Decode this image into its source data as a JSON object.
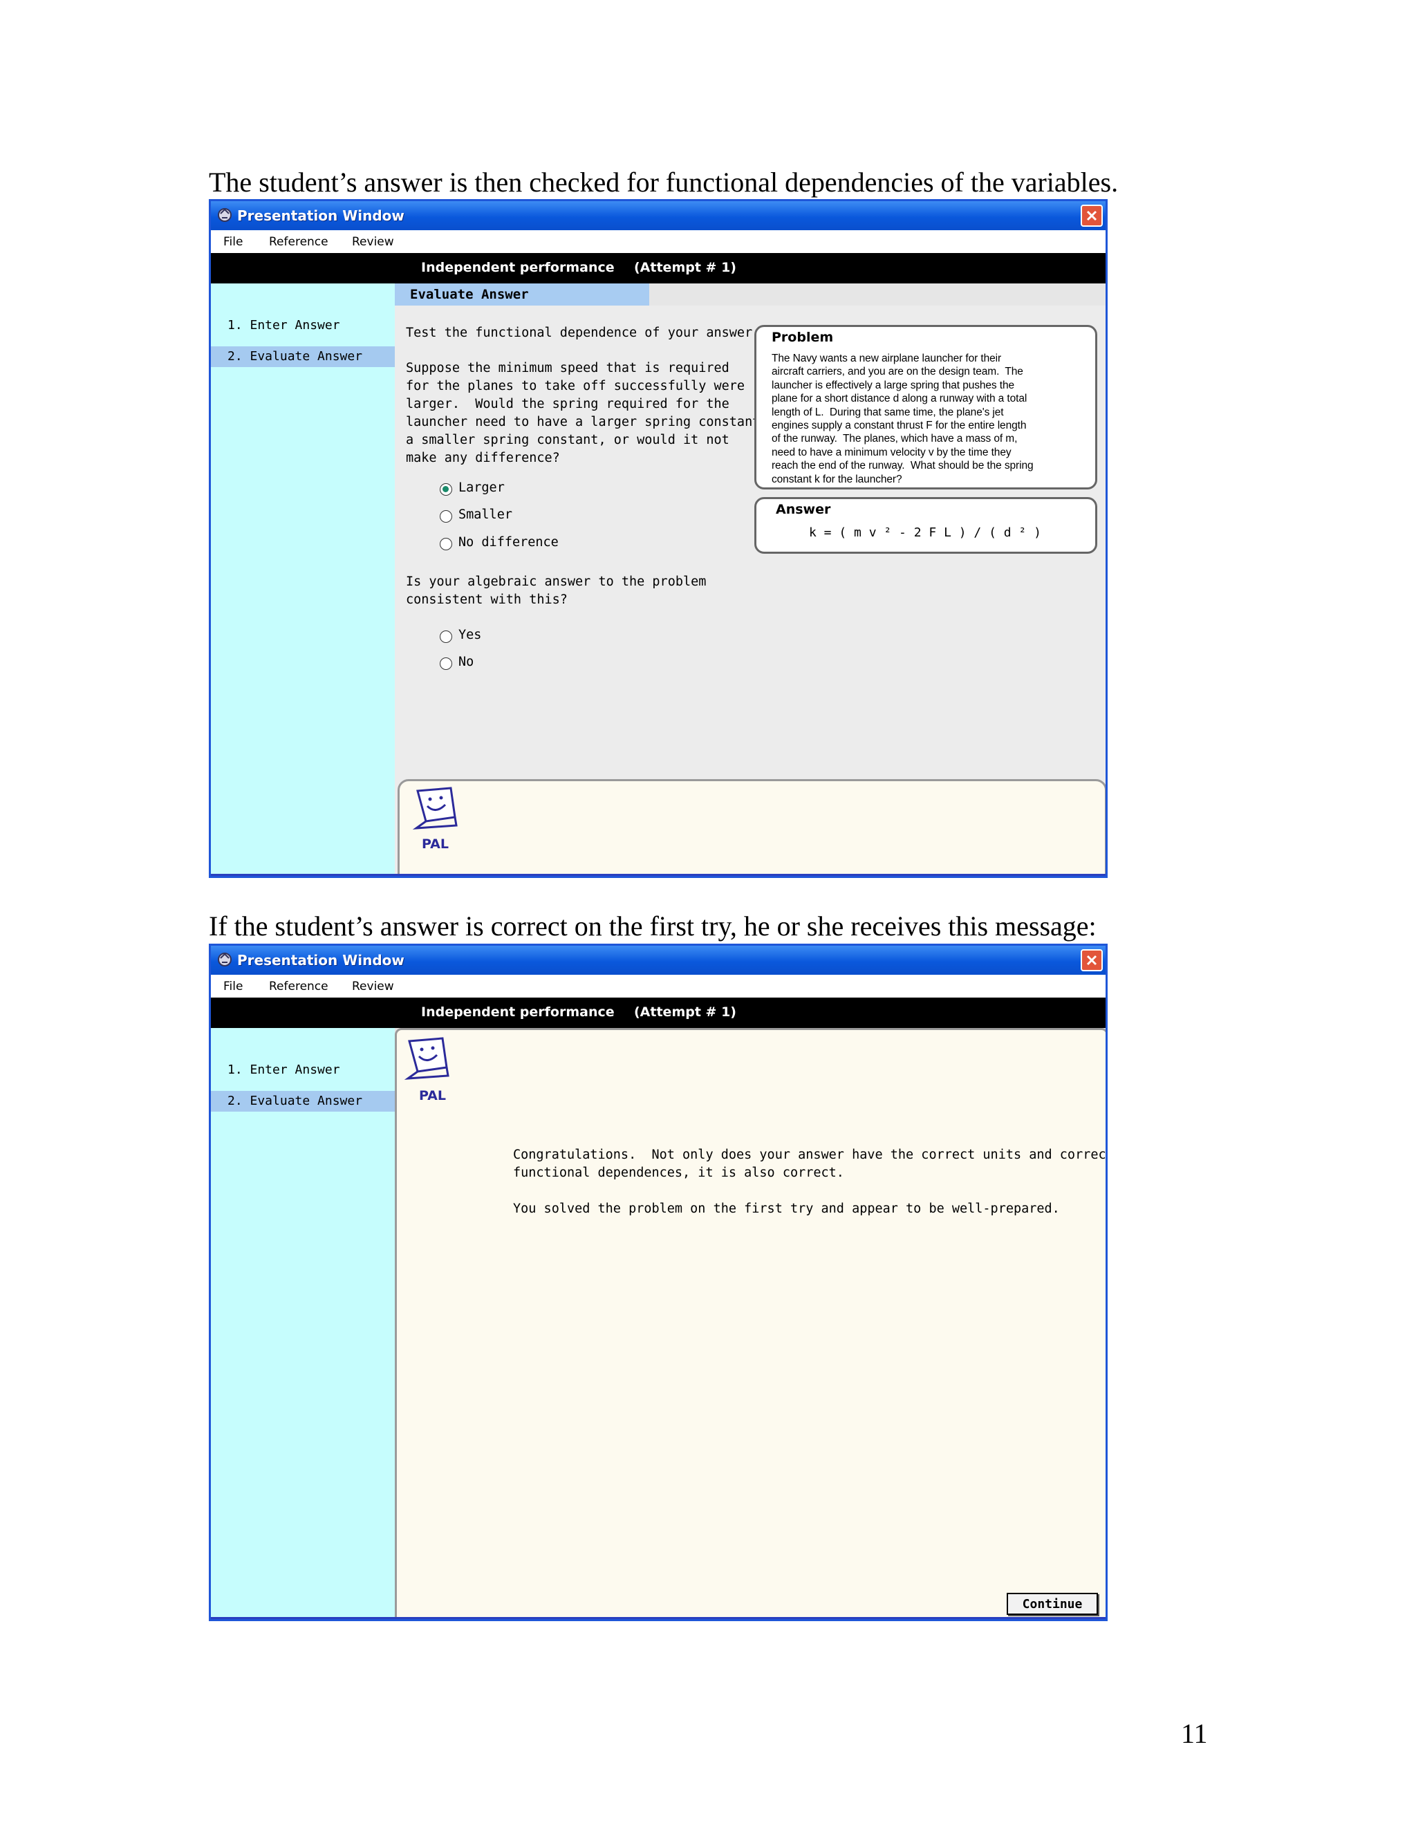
{
  "captions": {
    "top": "The student’s answer is then checked for functional dependencies of the variables.",
    "bottom": "If the student’s answer is correct on the first try, he or she receives this message:"
  },
  "page_number": "11",
  "window": {
    "title": "Presentation Window",
    "menu": [
      "File",
      "Reference",
      "Review"
    ],
    "mode": "Independent performance",
    "attempt": "(Attempt # 1)",
    "steps": [
      "1. Enter Answer",
      "2. Evaluate Answer"
    ],
    "pal_label": "PAL",
    "icons": {
      "title": "app-icon",
      "close": "close-icon",
      "pal": "pal-face-icon"
    }
  },
  "evaluate": {
    "section_title": "Evaluate Answer",
    "instruction": "Test the functional dependence of your answer",
    "question1": "Suppose the minimum speed that is required\nfor the planes to take off successfully were\nlarger.  Would the spring required for the\nlauncher need to have a larger spring constant,\na smaller spring constant, or would it not\nmake any difference?",
    "options1": [
      "Larger",
      "Smaller",
      "No difference"
    ],
    "selected1": "Larger",
    "question2": "Is your algebraic answer to the problem\nconsistent with this?",
    "options2": [
      "Yes",
      "No"
    ],
    "problem_title": "Problem",
    "problem_text": "The Navy wants a new airplane launcher for their\naircraft carriers, and you are on the design team.  The\nlauncher is effectively a large spring that pushes the\nplane for a short distance d along a runway with a total\nlength of L.  During that same time, the plane's jet\nengines supply a constant thrust F for the entire length\nof the runway.  The planes, which have a mass of m,\nneed to have a minimum velocity v by the time they\nreach the end of the runway.  What should be the spring\nconstant k for the launcher?",
    "answer_title": "Answer",
    "answer_text": "k = ( m v ² - 2 F L ) / ( d ² )"
  },
  "congrats": {
    "line1": "Congratulations.  Not only does your answer have the correct units and correct\nfunctional dependences, it is also correct.",
    "line2": "You solved the problem on the first try and appear to be well-prepared.",
    "continue_label": "Continue"
  },
  "colors": {
    "titlebar": "#0a58dc",
    "sidebar": "#c6fdfd",
    "selected_step": "#a5caf0",
    "header_bar": "#000000",
    "pal": "#2b2a9a"
  }
}
